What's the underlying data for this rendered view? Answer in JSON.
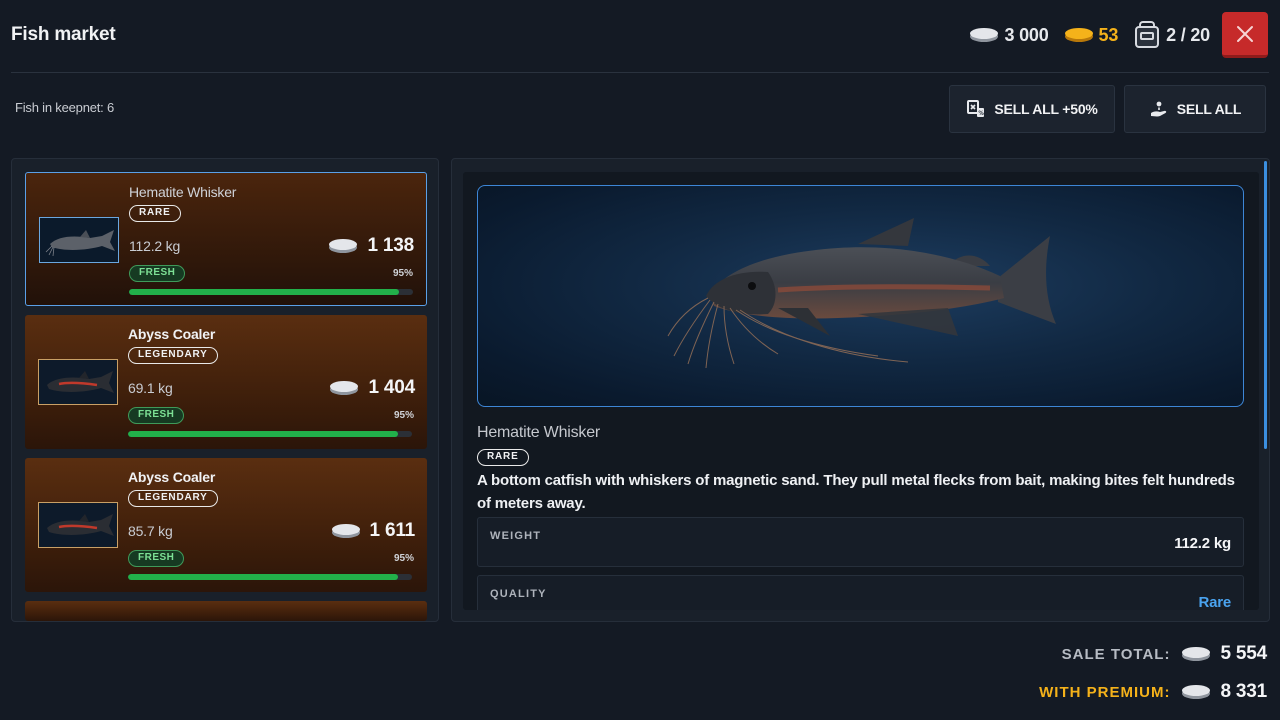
{
  "header": {
    "title": "Fish market",
    "silver": "3 000",
    "gold": "53",
    "capacity": "2 / 20"
  },
  "keepnet_text": "Fish in keepnet: 6",
  "actions": {
    "sell_all_bonus": "SELL ALL +50%",
    "sell_all": "SELL ALL"
  },
  "fish_list": [
    {
      "name": "Hematite Whisker",
      "rarity": "RARE",
      "weight": "112.2 kg",
      "price": "1 138",
      "freshness": "FRESH",
      "fresh_pct": "95%",
      "fresh_fraction": 0.95,
      "selected": true
    },
    {
      "name": "Abyss Coaler",
      "rarity": "LEGENDARY",
      "weight": "69.1 kg",
      "price": "1 404",
      "freshness": "FRESH",
      "fresh_pct": "95%",
      "fresh_fraction": 0.95,
      "selected": false
    },
    {
      "name": "Abyss Coaler",
      "rarity": "LEGENDARY",
      "weight": "85.7 kg",
      "price": "1 611",
      "freshness": "FRESH",
      "fresh_pct": "95%",
      "fresh_fraction": 0.95,
      "selected": false
    }
  ],
  "detail": {
    "name": "Hematite Whisker",
    "rarity": "RARE",
    "description": "A bottom catfish with whiskers of magnetic sand. They pull metal flecks from bait, making bites felt hundreds of meters away.",
    "weight_label": "WEIGHT",
    "weight_value": "112.2 kg",
    "quality_label": "QUALITY",
    "quality_value": "Rare"
  },
  "totals": {
    "sale_label": "SALE TOTAL:",
    "sale_value": "5 554",
    "premium_label": "WITH PREMIUM:",
    "premium_value": "8 331"
  },
  "colors": {
    "gold": "#f5b21a",
    "close": "#c62a2a",
    "fresh_bar": "#22b04a",
    "accent_blue": "#3d86d6"
  },
  "icons": {
    "silver": "silver-coin-icon",
    "gold": "gold-coin-icon",
    "capacity": "backpack-icon",
    "close": "close-icon",
    "sell_bonus": "sell-bonus-icon",
    "sell_all": "sell-hand-icon"
  }
}
